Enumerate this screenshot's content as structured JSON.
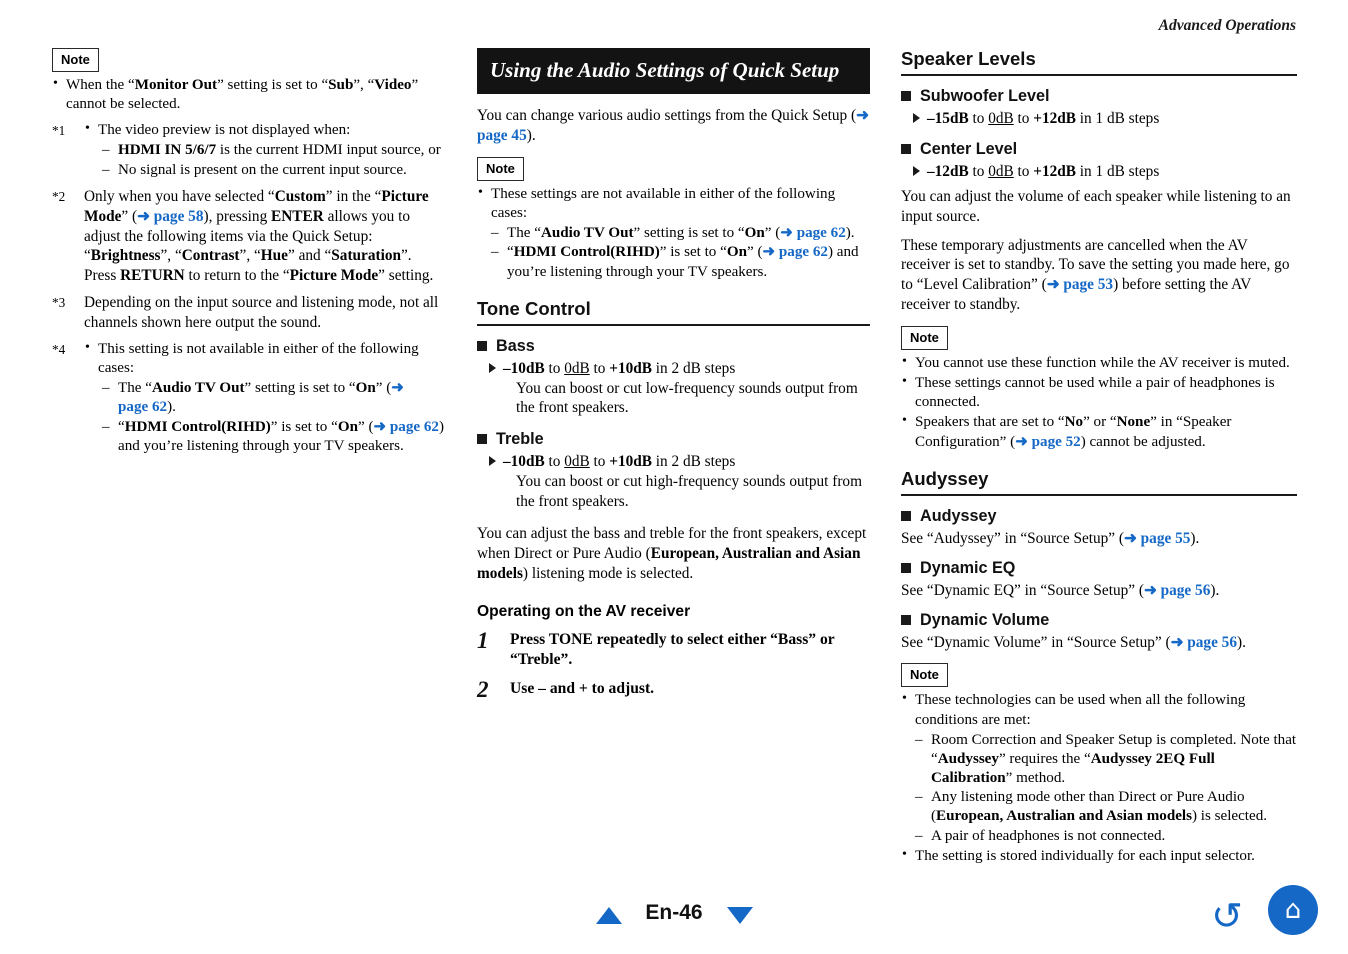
{
  "running_head": "Advanced Operations",
  "note_label": "Note",
  "arrow_glyph": "➜",
  "accent_color": "#1668c6",
  "col1": {
    "note_bullets": [
      {
        "pre": "When the “",
        "b1": "Monitor Out",
        "mid": "” setting is set to “",
        "b2": "Sub",
        "mid2": "”, “",
        "b3": "Video",
        "post": "” cannot be selected."
      }
    ],
    "footnotes": [
      {
        "mark": "*1",
        "bullet": "The video preview is not displayed when:",
        "dashes": [
          {
            "b": "HDMI IN 5/6/7",
            "rest": " is the current HDMI input source, or"
          },
          {
            "b": "",
            "rest": "No signal is present on the current input source."
          }
        ]
      },
      {
        "mark": "*2",
        "text_parts": [
          "Only when you have selected “",
          "Custom",
          "” in the “",
          "Picture Mode",
          "” (",
          "page 58",
          "), pressing ",
          "ENTER",
          " allows you to adjust the following items via the Quick Setup: “",
          "Brightness",
          "”, “",
          "Contrast",
          "”, “",
          "Hue",
          "” and “",
          "Saturation",
          "”. Press ",
          "RETURN",
          " to return to the “",
          "Picture Mode",
          "” setting."
        ]
      },
      {
        "mark": "*3",
        "plain": "Depending on the input source and listening mode, not all channels shown here output the sound."
      },
      {
        "mark": "*4",
        "bullet": "This setting is not available in either of the following cases:",
        "dashes2": [
          {
            "pre": "The “",
            "b": "Audio TV Out",
            "mid": "” setting is set to “",
            "b2": "On",
            "mid2": "” (",
            "link": "page 62",
            "post": ")."
          },
          {
            "pre": "“",
            "b": "HDMI Control(RIHD)",
            "mid": "” is set to “",
            "b2": "On",
            "mid2": "” (",
            "link": "page 62",
            "post": ") and you’re listening through your TV speakers."
          }
        ]
      }
    ]
  },
  "col2": {
    "title": "Using the Audio Settings of Quick Setup",
    "intro_pre": "You can change various audio settings from the Quick Setup (",
    "intro_link": "page 45",
    "intro_post": ").",
    "note_intro": "These settings are not available in either of the following cases:",
    "note_dashes": [
      {
        "pre": "The “",
        "b": "Audio TV Out",
        "mid": "” setting is set to “",
        "b2": "On",
        "mid2": "” (",
        "link": "page 62",
        "post": ")."
      },
      {
        "pre": "“",
        "b": "HDMI Control(RIHD)",
        "mid": "” is set to “",
        "b2": "On",
        "mid2": "” (",
        "link": "page 62",
        "post": ") and you’re listening through your TV speakers."
      }
    ],
    "tone_control_title": "Tone Control",
    "bass_title": "Bass",
    "bass_range": {
      "min": "–10dB",
      "to1": " to ",
      "mid": "0dB",
      "to2": " to ",
      "max": "+10dB",
      "steps": " in 2 dB steps"
    },
    "bass_desc": "You can boost or cut low-frequency sounds output from the front speakers.",
    "treble_title": "Treble",
    "treble_range": {
      "min": "–10dB",
      "to1": " to ",
      "mid": "0dB",
      "to2": " to ",
      "max": "+10dB",
      "steps": " in 2 dB steps"
    },
    "treble_desc": "You can boost or cut high-frequency sounds output from the front speakers.",
    "adjust_para": [
      "You can adjust the bass and treble for the front speakers, except when Direct or Pure Audio (",
      "European, Australian and Asian models",
      ") listening mode is selected."
    ],
    "operating_title": "Operating on the AV receiver",
    "steps": [
      {
        "num": "1",
        "text": "Press TONE repeatedly to select either “Bass” or “Treble”."
      },
      {
        "num": "2",
        "text": "Use – and + to adjust."
      }
    ]
  },
  "col3": {
    "speaker_levels_title": "Speaker Levels",
    "subwoofer_title": "Subwoofer Level",
    "subwoofer_range": {
      "min": "–15dB",
      "to1": " to ",
      "mid": "0dB",
      "to2": " to ",
      "max": "+12dB",
      "steps": " in 1 dB steps"
    },
    "center_title": "Center Level",
    "center_range": {
      "min": "–12dB",
      "to1": " to ",
      "mid": "0dB",
      "to2": " to ",
      "max": "+12dB",
      "steps": " in 1 dB steps"
    },
    "para1": "You can adjust the volume of each speaker while listening to an input source.",
    "para2_parts": [
      "These temporary adjustments are cancelled when the AV receiver is set to standby. To save the setting you made here, go to “Level Calibration” (",
      "page 53",
      ") before setting the AV receiver to standby."
    ],
    "note_bullets": [
      {
        "plain": "You cannot use these function while the AV receiver is muted."
      },
      {
        "plain": "These settings cannot be used while a pair of headphones is connected."
      },
      {
        "pre": "Speakers that are set to “",
        "b": "No",
        "mid": "” or “",
        "b2": "None",
        "mid2": "” in “Speaker Configuration” (",
        "link": "page 52",
        "post": ") cannot be adjusted."
      }
    ],
    "audyssey_title": "Audyssey",
    "items": [
      {
        "head": "Audyssey",
        "pre": "See “Audyssey” in “Source Setup” (",
        "link": "page 55",
        "post": ")."
      },
      {
        "head": "Dynamic EQ",
        "pre": "See “Dynamic EQ” in “Source Setup” (",
        "link": "page 56",
        "post": ")."
      },
      {
        "head": "Dynamic Volume",
        "pre": "See “Dynamic Volume” in “Source Setup” (",
        "link": "page 56",
        "post": ")."
      }
    ],
    "note2_bullet1": "These technologies can be used when all the following conditions are met:",
    "note2_dashes": [
      {
        "pre": "Room Correction and Speaker Setup is completed. Note that “",
        "b": "Audyssey",
        "mid": "” requires the “",
        "b2": "Audyssey 2EQ Full Calibration",
        "post": "” method."
      },
      {
        "pre": "Any listening mode other than Direct or Pure Audio (",
        "b": "European, Australian and Asian models",
        "post": ") is selected."
      },
      {
        "pre": "A pair of headphones is not connected.",
        "b": "",
        "post": ""
      }
    ],
    "note2_bullet2": "The setting is stored individually for each input selector."
  },
  "footer": {
    "page_label": "En-46",
    "up_name": "previous-page",
    "down_name": "next-page",
    "back_glyph": "↺",
    "home_glyph": "⌂"
  }
}
